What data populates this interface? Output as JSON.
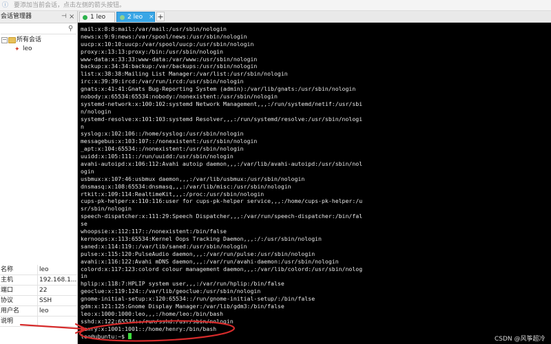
{
  "hint_bar": {
    "text": "要添加当前会话，点击左侧的箭头按钮。",
    "icon": "info-icon"
  },
  "sidebar": {
    "title": "会话管理器",
    "pin_glyph": "⊣",
    "close_glyph": "×",
    "search_icon": "magnifier-icon",
    "tree": {
      "root_label": "所有会话",
      "sessions": [
        {
          "label": "leo",
          "icon": "ssh-session-icon"
        }
      ]
    },
    "properties": [
      {
        "key": "名称",
        "value": "leo"
      },
      {
        "key": "主机",
        "value": "192.168.1...."
      },
      {
        "key": "端口",
        "value": "22"
      },
      {
        "key": "协议",
        "value": "SSH"
      },
      {
        "key": "用户名",
        "value": "leo"
      },
      {
        "key": "说明",
        "value": ""
      }
    ]
  },
  "tabs": [
    {
      "label": "1 leo",
      "status_color": "#2bb24c",
      "active": false
    },
    {
      "label": "2 leo",
      "status_color": "#8fd18f",
      "active": true
    }
  ],
  "add_tab_glyph": "+",
  "terminal": {
    "lines": [
      "mail:x:8:8:mail:/var/mail:/usr/sbin/nologin",
      "news:x:9:9:news:/var/spool/news:/usr/sbin/nologin",
      "uucp:x:10:10:uucp:/var/spool/uucp:/usr/sbin/nologin",
      "proxy:x:13:13:proxy:/bin:/usr/sbin/nologin",
      "www-data:x:33:33:www-data:/var/www:/usr/sbin/nologin",
      "backup:x:34:34:backup:/var/backups:/usr/sbin/nologin",
      "list:x:38:38:Mailing List Manager:/var/list:/usr/sbin/nologin",
      "irc:x:39:39:ircd:/var/run/ircd:/usr/sbin/nologin",
      "gnats:x:41:41:Gnats Bug-Reporting System (admin):/var/lib/gnats:/usr/sbin/nologin",
      "nobody:x:65534:65534:nobody:/nonexistent:/usr/sbin/nologin",
      "systemd-network:x:100:102:systemd Network Management,,,:/run/systemd/netif:/usr/sbi",
      "n/nologin",
      "systemd-resolve:x:101:103:systemd Resolver,,,:/run/systemd/resolve:/usr/sbin/nologi",
      "n",
      "syslog:x:102:106::/home/syslog:/usr/sbin/nologin",
      "messagebus:x:103:107::/nonexistent:/usr/sbin/nologin",
      "_apt:x:104:65534::/nonexistent:/usr/sbin/nologin",
      "uuidd:x:105:111::/run/uuidd:/usr/sbin/nologin",
      "avahi-autoipd:x:106:112:Avahi autoip daemon,,,:/var/lib/avahi-autoipd:/usr/sbin/nol",
      "ogin",
      "usbmux:x:107:46:usbmux daemon,,,:/var/lib/usbmux:/usr/sbin/nologin",
      "dnsmasq:x:108:65534:dnsmasq,,,:/var/lib/misc:/usr/sbin/nologin",
      "rtkit:x:109:114:RealtimeKit,,,:/proc:/usr/sbin/nologin",
      "cups-pk-helper:x:110:116:user for cups-pk-helper service,,,:/home/cups-pk-helper:/u",
      "sr/sbin/nologin",
      "speech-dispatcher:x:111:29:Speech Dispatcher,,,:/var/run/speech-dispatcher:/bin/fal",
      "se",
      "whoopsie:x:112:117::/nonexistent:/bin/false",
      "kernoops:x:113:65534:Kernel Oops Tracking Daemon,,,:/:/usr/sbin/nologin",
      "saned:x:114:119::/var/lib/saned:/usr/sbin/nologin",
      "pulse:x:115:120:PulseAudio daemon,,,:/var/run/pulse:/usr/sbin/nologin",
      "avahi:x:116:122:Avahi mDNS daemon,,,:/var/run/avahi-daemon:/usr/sbin/nologin",
      "colord:x:117:123:colord colour management daemon,,,:/var/lib/colord:/usr/sbin/nolog",
      "in",
      "hplip:x:118:7:HPLIP system user,,,:/var/run/hplip:/bin/false",
      "geoclue:x:119:124::/var/lib/geoclue:/usr/sbin/nologin",
      "gnome-initial-setup:x:120:65534::/run/gnome-initial-setup/:/bin/false",
      "gdm:x:121:125:Gnome Display Manager:/var/lib/gdm3:/bin/false",
      "leo:x:1000:1000:leo,,,:/home/leo:/bin/bash",
      "sshd:x:122:65534::/run/sshd:/usr/sbin/nologin",
      "henry:x:1001:1001::/home/henry:/bin/bash"
    ],
    "prompt": "leo@ubuntu:~$ ",
    "cursor_color": "#3ddc3d"
  },
  "annotation": {
    "color": "#d62b2b"
  },
  "watermark": "CSDN @风筝超冷"
}
